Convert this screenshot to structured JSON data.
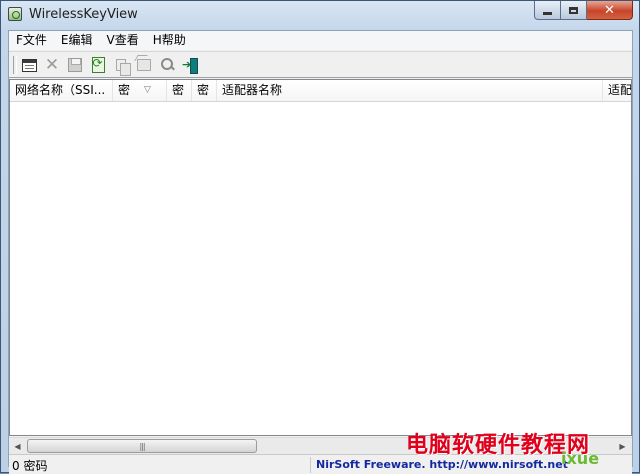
{
  "window": {
    "title": "WirelessKeyView"
  },
  "menu": [
    {
      "label": "F文件"
    },
    {
      "label": "E编辑"
    },
    {
      "label": "V查看"
    },
    {
      "label": "H帮助"
    }
  ],
  "toolbar": {
    "icons": [
      "properties-icon",
      "delete-icon",
      "save-icon",
      "refresh-icon",
      "copy-icon",
      "html-report-icon",
      "find-icon",
      "exit-icon"
    ]
  },
  "list": {
    "columns": [
      {
        "label": "网络名称（SSI..."
      },
      {
        "label": "密"
      },
      {
        "label": "密"
      },
      {
        "label": "密"
      },
      {
        "label": "适配器名称"
      },
      {
        "label": "适配"
      }
    ],
    "sort_indicator": "▽",
    "rows": []
  },
  "scrollbar": {
    "thumb_grip": "|||"
  },
  "status": {
    "count": "0 密码",
    "link": "NirSoft Freeware.  http://www.nirsoft.net"
  },
  "watermark": {
    "text": "电脑软硬件教程网",
    "sub": "ixue"
  }
}
